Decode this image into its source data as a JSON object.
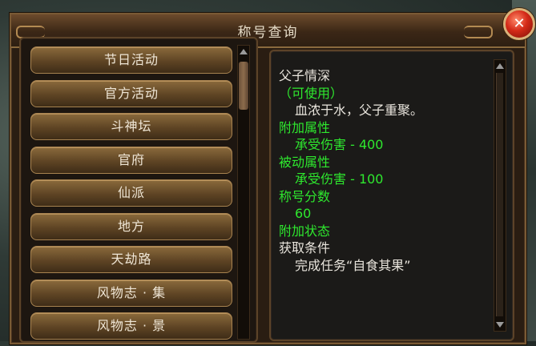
{
  "window": {
    "title": "称号查询"
  },
  "close": {
    "label": "✕"
  },
  "categories": [
    "节日活动",
    "官方活动",
    "斗神坛",
    "官府",
    "仙派",
    "地方",
    "天劫路",
    "风物志 · 集",
    "风物志 · 景"
  ],
  "detail": {
    "name": "父子情深",
    "status": "（可使用）",
    "description": "血浓于水，父子重聚。",
    "bonus_label": "附加属性",
    "bonus_value": "承受伤害 - 400",
    "passive_label": "被动属性",
    "passive_value": "承受伤害 - 100",
    "score_label": "称号分数",
    "score_value": "60",
    "state_label": "附加状态",
    "obtain_label": "获取条件",
    "obtain_value": "完成任务“自食其果”"
  },
  "colors": {
    "highlight": "#2ee82e",
    "text": "#e8e4dc",
    "frame": "#7a5a34",
    "button": "#8a6a3c"
  }
}
